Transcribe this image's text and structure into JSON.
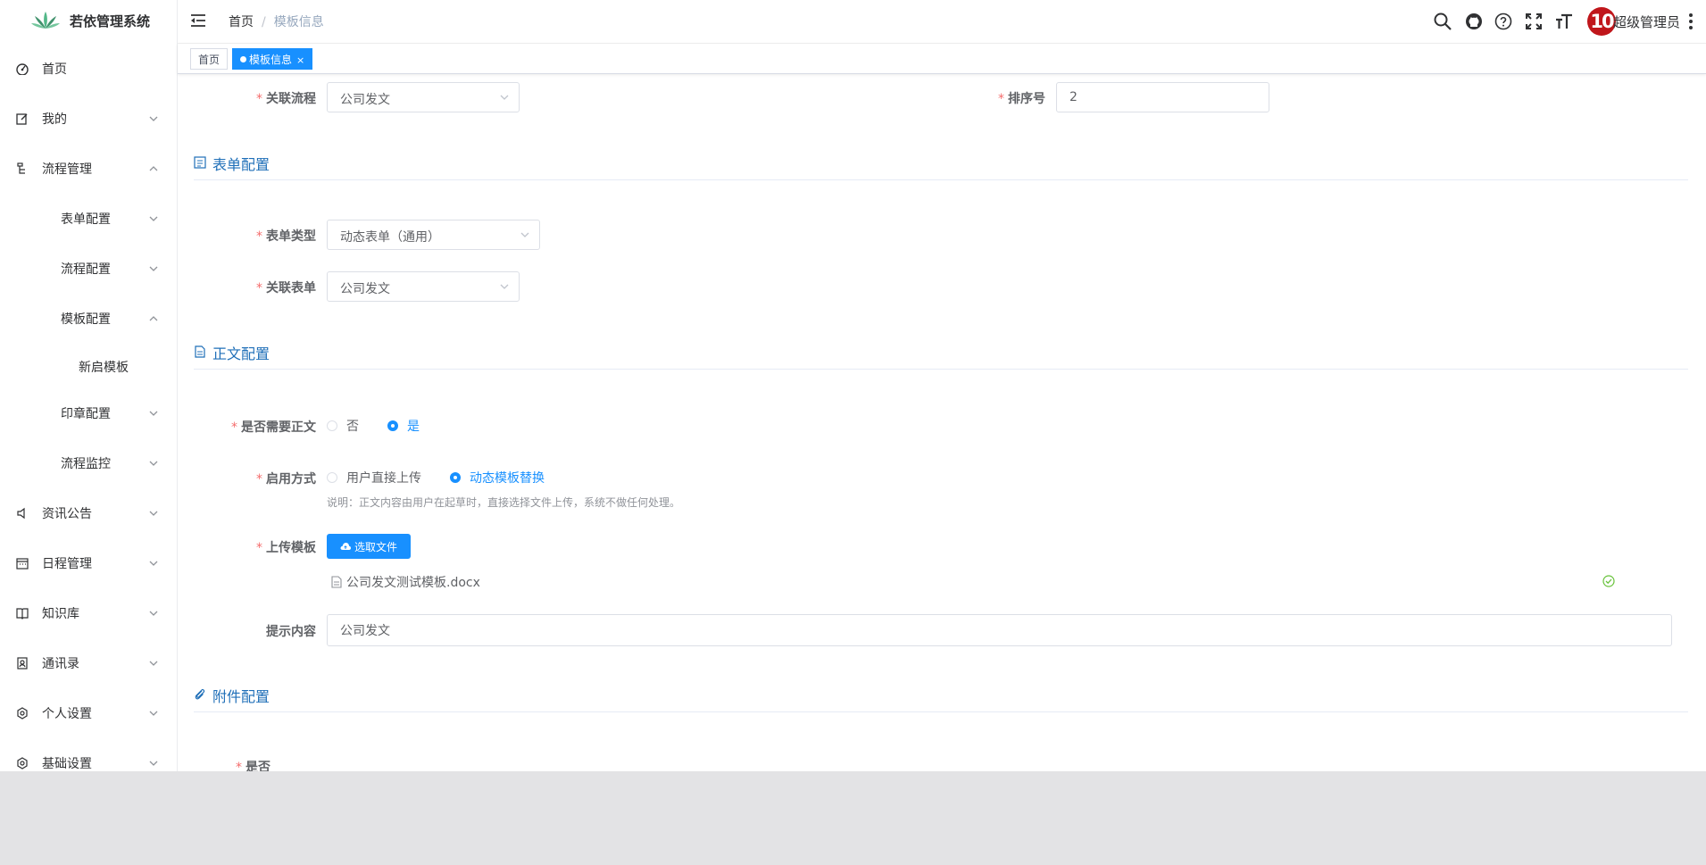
{
  "app": {
    "title": "若依管理系统"
  },
  "sidebar": {
    "items": [
      {
        "label": "首页",
        "icon": "dashboard-icon"
      },
      {
        "label": "我的",
        "icon": "edit-icon"
      },
      {
        "label": "流程管理",
        "icon": "tree-icon"
      },
      {
        "label": "表单配置"
      },
      {
        "label": "流程配置"
      },
      {
        "label": "模板配置"
      },
      {
        "label": "新启模板"
      },
      {
        "label": "印章配置"
      },
      {
        "label": "流程监控"
      },
      {
        "label": "资讯公告",
        "icon": "message-icon"
      },
      {
        "label": "日程管理",
        "icon": "calendar-icon"
      },
      {
        "label": "知识库",
        "icon": "book-icon"
      },
      {
        "label": "通讯录",
        "icon": "contacts-icon"
      },
      {
        "label": "个人设置",
        "icon": "gear-icon"
      },
      {
        "label": "基础设置",
        "icon": "gear-icon"
      }
    ]
  },
  "header": {
    "breadcrumb": [
      "首页",
      "模板信息"
    ],
    "breadcrumb_sep": "/",
    "avatar_text": "10",
    "username": "超级管理员"
  },
  "tags": {
    "home": "首页",
    "active": "模板信息",
    "close": "×"
  },
  "form": {
    "flow_label": "关联流程",
    "flow_value": "公司发文",
    "sort_label": "排序号",
    "sort_value": "2",
    "section_form": "表单配置",
    "form_type_label": "表单类型",
    "form_type_value": "动态表单（通用）",
    "related_form_label": "关联表单",
    "related_form_value": "公司发文",
    "section_body": "正文配置",
    "need_body_label": "是否需要正文",
    "need_body_options": [
      "否",
      "是"
    ],
    "enable_mode_label": "启用方式",
    "enable_mode_options": [
      "用户直接上传",
      "动态模板替换"
    ],
    "enable_mode_hint": "说明：正文内容由用户在起草时，直接选择文件上传，系统不做任何处理。",
    "upload_label": "上传模板",
    "upload_button": "选取文件",
    "uploaded_file": "公司发文测试模板.docx",
    "tip_label": "提示内容",
    "tip_value": "公司发文",
    "section_attach": "附件配置",
    "partial_label": "是否"
  },
  "colors": {
    "accent": "#1890ff",
    "section": "#1f6fb8",
    "required": "#f56c6c",
    "success": "#67c23a",
    "avatar": "#c0161b"
  }
}
